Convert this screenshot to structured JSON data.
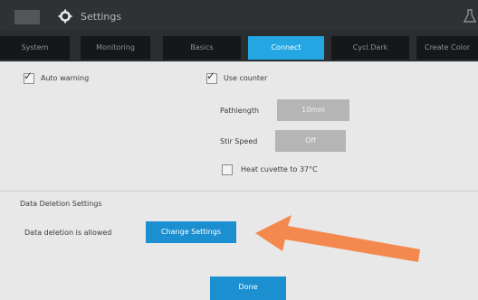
{
  "header": {
    "title": "Settings"
  },
  "tabs": [
    {
      "label": "System",
      "active": false
    },
    {
      "label": "Monitoring",
      "active": false
    },
    {
      "label": "Basics",
      "active": false
    },
    {
      "label": "Connect",
      "active": true
    },
    {
      "label": "Cycl.Dark",
      "active": false
    },
    {
      "label": "Create Color",
      "active": false
    }
  ],
  "options": {
    "auto_warning": {
      "label": "Auto warning",
      "checked": true
    },
    "use_counter": {
      "label": "Use counter",
      "checked": true
    },
    "path_length": {
      "label": "Pathlength",
      "value": "10mm"
    },
    "stir_speed": {
      "label": "Stir Speed",
      "value": "Off"
    },
    "heat_cuvette": {
      "label": "Heat cuvette to 37°C",
      "checked": false
    }
  },
  "data_deletion": {
    "section_title": "Data Deletion Settings",
    "status_text": "Data deletion is allowed",
    "change_button": "Change Settings"
  },
  "footer": {
    "done_button": "Done"
  },
  "colors": {
    "accent": "#23a6e2",
    "button": "#1c8fd0",
    "arrow": "#f4894f"
  }
}
